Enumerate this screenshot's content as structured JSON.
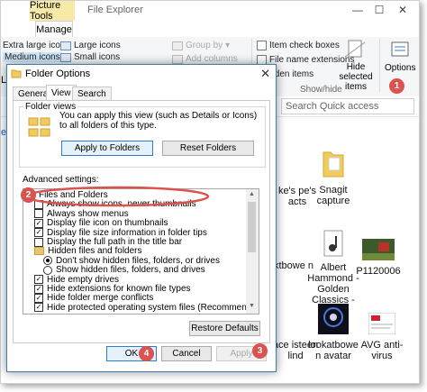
{
  "explorer": {
    "contextual_tab": "Picture Tools",
    "title": "File Explorer",
    "window_controls": [
      "—",
      "☐",
      "✕"
    ],
    "manage_tab": "Manage",
    "ribbon": {
      "extra_large_icons": "Extra large icons",
      "large_icons": "Large icons",
      "medium_icons": "Medium icons",
      "small_icons": "Small icons",
      "group_by": "Group by",
      "add_columns": "Add columns",
      "item_check_boxes": "Item check boxes",
      "file_name_extensions": "File name extensions",
      "hidden_items": "idden items",
      "hide_selected_items": "Hide selected items",
      "options": "Options",
      "show_hide": "Show/hide"
    },
    "search_placeholder": "Search Quick access",
    "left_stub_labels": [
      "ers",
      "L"
    ],
    "files": [
      {
        "name": "ke's pe's acts"
      },
      {
        "name": "Snagit capture"
      },
      {
        "name": "ktbowe n"
      },
      {
        "name": "Albert Hammond - Golden Classics - ..."
      },
      {
        "name": "P1120006"
      },
      {
        "name": "ace isteen lind"
      },
      {
        "name": "lookatbowe n avatar"
      },
      {
        "name": "AVG anti-virus"
      }
    ]
  },
  "dialog": {
    "title": "Folder Options",
    "close": "✕",
    "tabs": [
      "General",
      "View",
      "Search"
    ],
    "folder_views": {
      "heading": "Folder views",
      "description": "You can apply this view (such as Details or Icons) to all folders of this type.",
      "apply_button": "Apply to Folders",
      "reset_button": "Reset Folders"
    },
    "advanced_label": "Advanced settings:",
    "settings": [
      {
        "type": "folder",
        "label": "Files and Folders",
        "indent": 0
      },
      {
        "type": "check",
        "label": "Always show icons, never thumbnails",
        "checked": false,
        "indent": 1
      },
      {
        "type": "check",
        "label": "Always show menus",
        "checked": false,
        "indent": 1
      },
      {
        "type": "check",
        "label": "Display file icon on thumbnails",
        "checked": true,
        "indent": 1
      },
      {
        "type": "check",
        "label": "Display file size information in folder tips",
        "checked": true,
        "indent": 1
      },
      {
        "type": "check",
        "label": "Display the full path in the title bar",
        "checked": false,
        "indent": 1
      },
      {
        "type": "folder",
        "label": "Hidden files and folders",
        "indent": 1
      },
      {
        "type": "radio",
        "label": "Don't show hidden files, folders, or drives",
        "checked": true,
        "indent": 2
      },
      {
        "type": "radio",
        "label": "Show hidden files, folders, and drives",
        "checked": false,
        "indent": 2
      },
      {
        "type": "check",
        "label": "Hide empty drives",
        "checked": true,
        "indent": 1
      },
      {
        "type": "check",
        "label": "Hide extensions for known file types",
        "checked": true,
        "indent": 1
      },
      {
        "type": "check",
        "label": "Hide folder merge conflicts",
        "checked": true,
        "indent": 1
      },
      {
        "type": "check",
        "label": "Hide protected operating system files (Recommended)",
        "checked": true,
        "indent": 1
      }
    ],
    "restore_button": "Restore Defaults",
    "ok_button": "OK",
    "cancel_button": "Cancel",
    "apply_button": "Apply"
  },
  "annotations": {
    "steps": [
      "1",
      "2",
      "3",
      "4"
    ],
    "badge_color": "#d9534f"
  }
}
